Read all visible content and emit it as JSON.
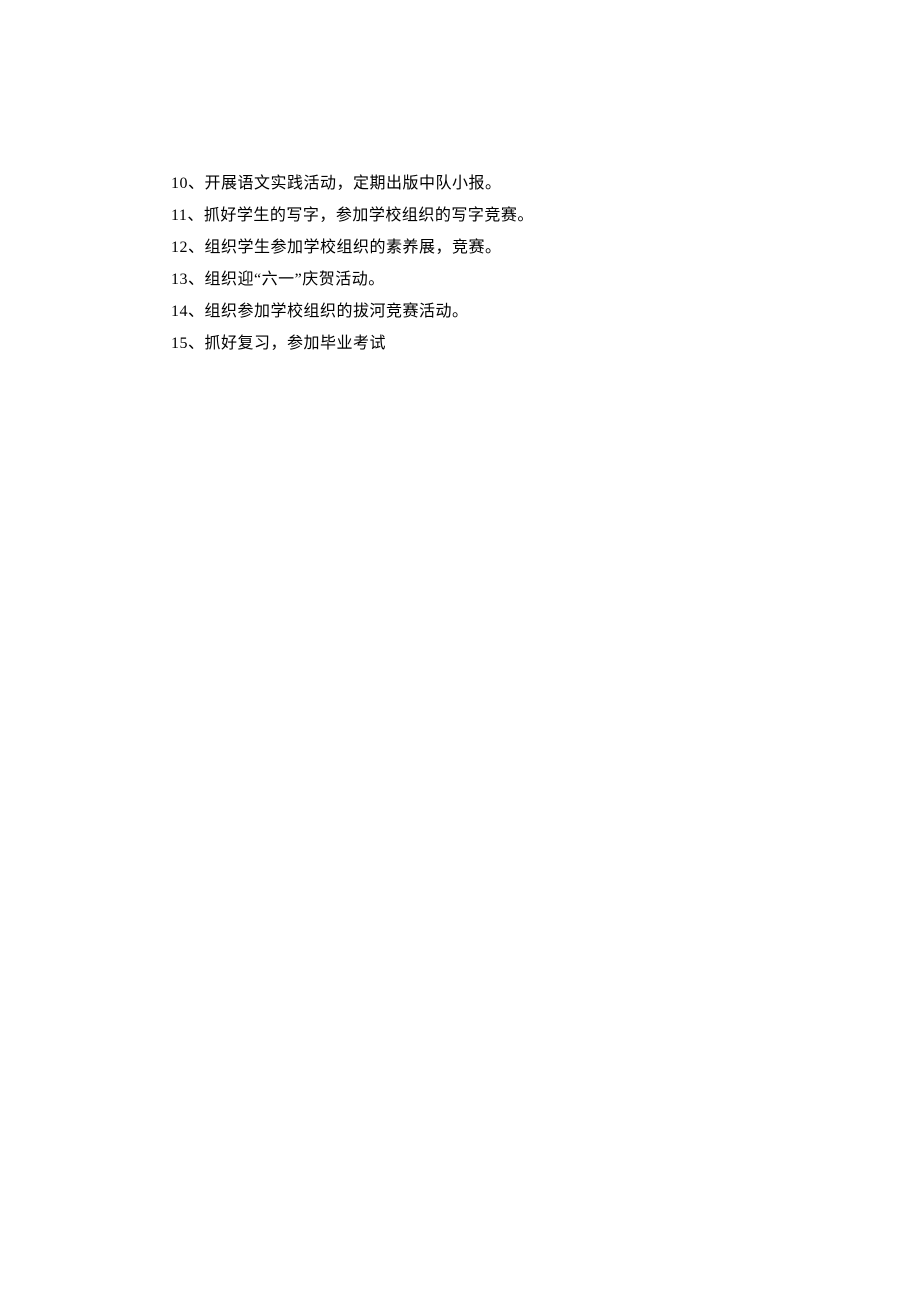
{
  "items": [
    {
      "num": "10",
      "text": "、开展语文实践活动，定期出版中队小报。"
    },
    {
      "num": "11",
      "text": "、抓好学生的写字，参加学校组织的写字竞赛。"
    },
    {
      "num": "12",
      "text": "、组织学生参加学校组织的素养展，竞赛。"
    },
    {
      "num": "13",
      "text": "、组织迎“六一”庆贺活动。"
    },
    {
      "num": "14",
      "text": "、组织参加学校组织的拔河竞赛活动。"
    },
    {
      "num": "15",
      "text": "、抓好复习，参加毕业考试"
    }
  ]
}
